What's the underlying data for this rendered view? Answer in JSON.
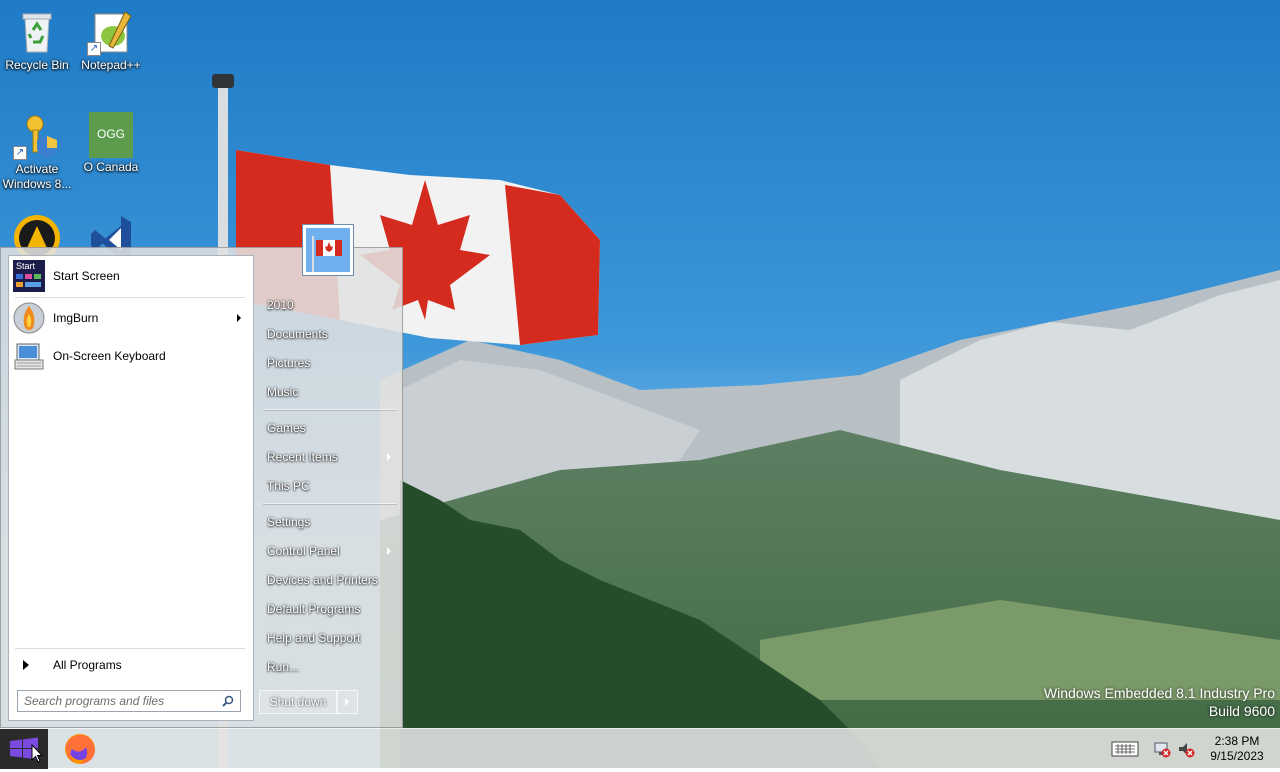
{
  "desktop": {
    "icons": [
      {
        "label": "Recycle Bin",
        "icon": "recycle-bin-icon"
      },
      {
        "label": "Notepad++",
        "icon": "notepad-plus-plus-icon"
      },
      {
        "label": "Activate Windows 8...",
        "icon": "key-shield-icon"
      },
      {
        "label": "O Canada",
        "icon": "ogg-audio-file-icon",
        "badge": "OGG"
      },
      {
        "label": "",
        "icon": "aimp-icon"
      },
      {
        "label": "",
        "icon": "visual-studio-icon"
      }
    ]
  },
  "start_menu": {
    "pinned": [
      {
        "label": "Start Screen",
        "icon": "start-screen-icon",
        "icon_text": "Start"
      },
      {
        "label": "ImgBurn",
        "icon": "imgburn-icon",
        "has_submenu": true
      },
      {
        "label": "On-Screen Keyboard",
        "icon": "on-screen-keyboard-icon"
      }
    ],
    "all_programs_label": "All Programs",
    "search_placeholder": "Search programs and files",
    "right_pane": {
      "group1": [
        "2010",
        "Documents",
        "Pictures",
        "Music"
      ],
      "group2": [
        "Games",
        "Recent Items",
        "This PC"
      ],
      "group3": [
        "Settings",
        "Control Panel",
        "Devices and Printers",
        "Default Programs",
        "Help and Support",
        "Run..."
      ]
    },
    "shutdown_label": "Shut down"
  },
  "watermark": {
    "line1": "Windows Embedded 8.1 Industry Pro",
    "line2": "Build 9600"
  },
  "taskbar": {
    "apps": [
      "firefox-icon"
    ],
    "tray_icons": [
      "touch-keyboard-icon",
      "network-error-icon",
      "volume-muted-icon"
    ],
    "time": "2:38 PM",
    "date": "9/15/2023"
  },
  "colors": {
    "start_button": "#2b2b2b",
    "sky_top": "#1f7bc6",
    "sky_bottom": "#8fc8ee",
    "flag_red": "#d52b1e"
  }
}
